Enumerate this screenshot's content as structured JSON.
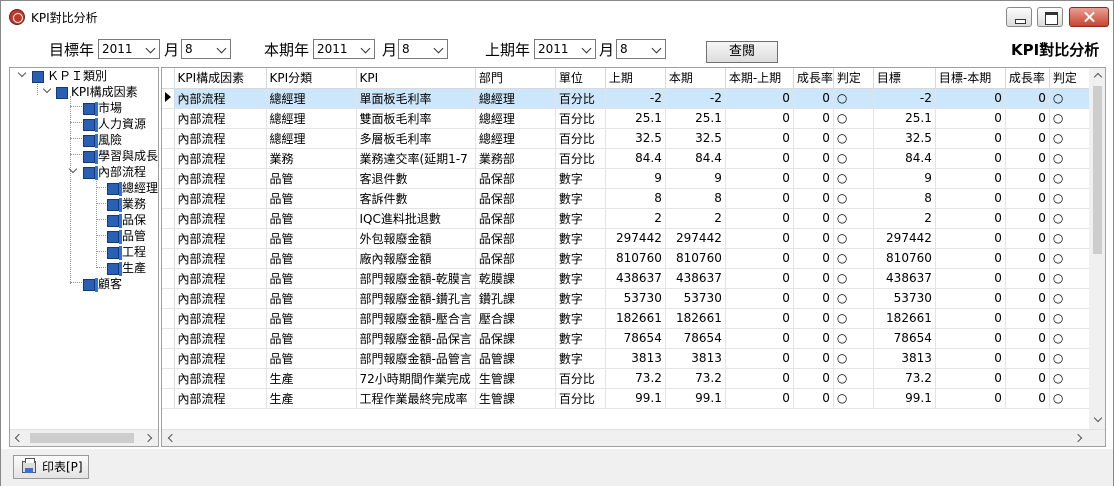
{
  "window": {
    "title": "KPI對比分析"
  },
  "filters": {
    "target_year_label": "目標年",
    "target_year": "2011",
    "target_month_label": "月",
    "target_month": "8",
    "current_year_label": "本期年",
    "current_year": "2011",
    "current_month_label": "月",
    "current_month": "8",
    "prev_year_label": "上期年",
    "prev_year": "2011",
    "prev_month_label": "月",
    "prev_month": "8",
    "query_label": "查閱",
    "page_title": "KPI對比分析"
  },
  "tree": {
    "root": "ＫＰＩ類別",
    "group": "KPI構成因素",
    "items": [
      "市場",
      "人力資源",
      "風險",
      "學習與成長",
      "內部流程",
      "顧客"
    ],
    "sub_items": [
      "總經理",
      "業務",
      "品保",
      "品管",
      "工程",
      "生產"
    ]
  },
  "table": {
    "columns": [
      "KPI構成因素",
      "KPI分類",
      "KPI",
      "部門",
      "單位",
      "上期",
      "本期",
      "本期-上期",
      "成長率",
      "判定",
      "目標",
      "目標-本期",
      "成長率",
      "判定"
    ],
    "rows": [
      [
        "內部流程",
        "總經理",
        "單面板毛利率",
        "總經理",
        "百分比",
        "-2",
        "-2",
        "0",
        "0",
        "○",
        "-2",
        "0",
        "0",
        "○"
      ],
      [
        "內部流程",
        "總經理",
        "雙面板毛利率",
        "總經理",
        "百分比",
        "25.1",
        "25.1",
        "0",
        "0",
        "○",
        "25.1",
        "0",
        "0",
        "○"
      ],
      [
        "內部流程",
        "總經理",
        "多層板毛利率",
        "總經理",
        "百分比",
        "32.5",
        "32.5",
        "0",
        "0",
        "○",
        "32.5",
        "0",
        "0",
        "○"
      ],
      [
        "內部流程",
        "業務",
        "業務達交率(延期1-7",
        "業務部",
        "百分比",
        "84.4",
        "84.4",
        "0",
        "0",
        "○",
        "84.4",
        "0",
        "0",
        "○"
      ],
      [
        "內部流程",
        "品管",
        "客退件數",
        "品保部",
        "數字",
        "9",
        "9",
        "0",
        "0",
        "○",
        "9",
        "0",
        "0",
        "○"
      ],
      [
        "內部流程",
        "品管",
        "客訴件數",
        "品保部",
        "數字",
        "8",
        "8",
        "0",
        "0",
        "○",
        "8",
        "0",
        "0",
        "○"
      ],
      [
        "內部流程",
        "品管",
        "IQC進料批退數",
        "品保部",
        "數字",
        "2",
        "2",
        "0",
        "0",
        "○",
        "2",
        "0",
        "0",
        "○"
      ],
      [
        "內部流程",
        "品管",
        "外包報廢金額",
        "品保部",
        "數字",
        "297442",
        "297442",
        "0",
        "0",
        "○",
        "297442",
        "0",
        "0",
        "○"
      ],
      [
        "內部流程",
        "品管",
        "廠內報廢金額",
        "品保部",
        "數字",
        "810760",
        "810760",
        "0",
        "0",
        "○",
        "810760",
        "0",
        "0",
        "○"
      ],
      [
        "內部流程",
        "品管",
        "部門報廢金額-乾膜言",
        "乾膜課",
        "數字",
        "438637",
        "438637",
        "0",
        "0",
        "○",
        "438637",
        "0",
        "0",
        "○"
      ],
      [
        "內部流程",
        "品管",
        "部門報廢金額-鑽孔言",
        "鑽孔課",
        "數字",
        "53730",
        "53730",
        "0",
        "0",
        "○",
        "53730",
        "0",
        "0",
        "○"
      ],
      [
        "內部流程",
        "品管",
        "部門報廢金額-壓合言",
        "壓合課",
        "數字",
        "182661",
        "182661",
        "0",
        "0",
        "○",
        "182661",
        "0",
        "0",
        "○"
      ],
      [
        "內部流程",
        "品管",
        "部門報廢金額-品保言",
        "品保課",
        "數字",
        "78654",
        "78654",
        "0",
        "0",
        "○",
        "78654",
        "0",
        "0",
        "○"
      ],
      [
        "內部流程",
        "品管",
        "部門報廢金額-品管言",
        "品管課",
        "數字",
        "3813",
        "3813",
        "0",
        "0",
        "○",
        "3813",
        "0",
        "0",
        "○"
      ],
      [
        "內部流程",
        "生產",
        "72小時期間作業完成",
        "生管課",
        "百分比",
        "73.2",
        "73.2",
        "0",
        "0",
        "○",
        "73.2",
        "0",
        "0",
        "○"
      ],
      [
        "內部流程",
        "生產",
        "工程作業最終完成率",
        "生管課",
        "百分比",
        "99.1",
        "99.1",
        "0",
        "0",
        "○",
        "99.1",
        "0",
        "0",
        "○"
      ]
    ]
  },
  "bottom": {
    "print_label": "印表[P]"
  }
}
